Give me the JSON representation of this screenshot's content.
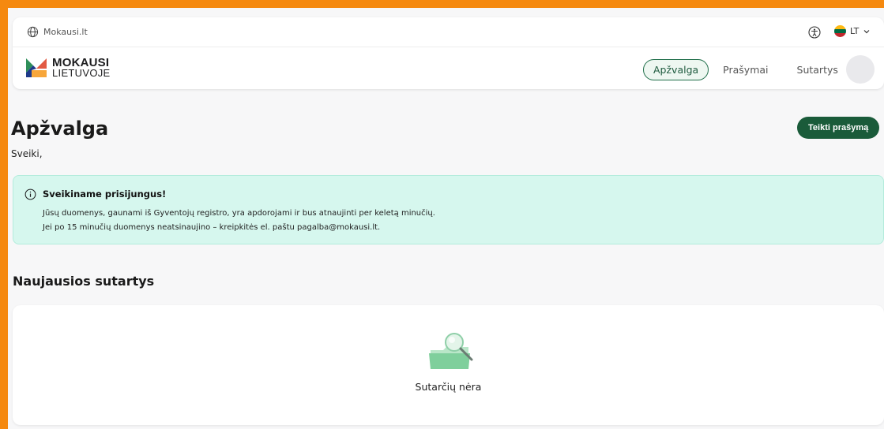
{
  "topbar": {
    "site_link": "Mokausi.lt",
    "language": "LT"
  },
  "logo": {
    "line1": "MOKAUSI",
    "line2": "LIETUVOJE"
  },
  "nav": {
    "items": [
      {
        "label": "Apžvalga",
        "active": true
      },
      {
        "label": "Prašymai",
        "active": false
      },
      {
        "label": "Sutartys",
        "active": false
      }
    ]
  },
  "page": {
    "title": "Apžvalga",
    "greeting": "Sveiki,",
    "primary_button": "Teikti prašymą"
  },
  "info": {
    "title": "Sveikiname prisijungus!",
    "line1": "Jūsų duomenys, gaunami iš Gyventojų registro, yra apdorojami ir bus atnaujinti per keletą minučių.",
    "line2": "Jei po 15 minučių duomenys neatsinaujino – kreipkitės el. paštu pagalba@mokausi.lt."
  },
  "contracts": {
    "section_title": "Naujausios sutartys",
    "empty_text": "Sutarčių nėra"
  },
  "colors": {
    "frame": "#f5890f",
    "primary": "#1a5b3a",
    "info_bg": "#d6f7ee"
  }
}
